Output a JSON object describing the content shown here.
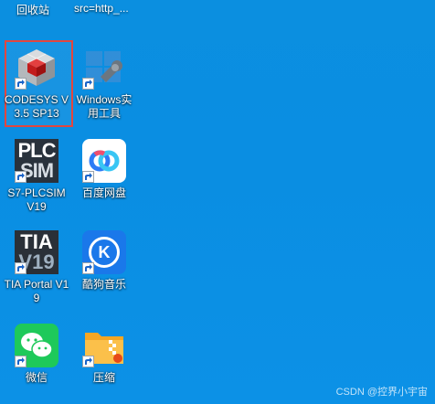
{
  "desktop": {
    "top_row": [
      {
        "label": "回收站"
      },
      {
        "label": "src=http_..."
      }
    ],
    "icons": [
      {
        "label": "CODESYS V3.5 SP13",
        "selected": true
      },
      {
        "label": "Windows实用工具"
      },
      {
        "label": "S7-PLCSIM V19"
      },
      {
        "label": "百度网盘"
      },
      {
        "label": "TIA Portal V19"
      },
      {
        "label": "酷狗音乐"
      },
      {
        "label": "微信"
      },
      {
        "label": "压缩"
      }
    ],
    "plcsim_logo_line1": "PLC",
    "plcsim_logo_line2": "SIM",
    "tia_logo_line1": "TIA",
    "tia_logo_line2": "V19",
    "kugou_letter": "K"
  },
  "watermark": "CSDN @控界小宇宙",
  "colors": {
    "background": "#0b8fe0",
    "selection_border": "#e2463f"
  }
}
